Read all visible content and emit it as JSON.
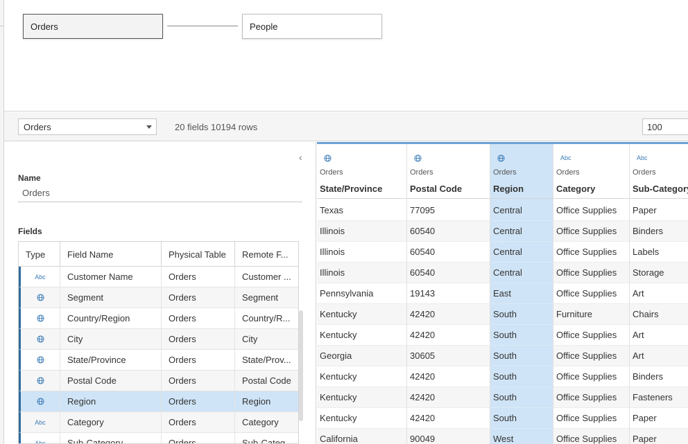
{
  "canvas": {
    "tables": [
      "Orders",
      "People"
    ]
  },
  "toolbar": {
    "selected_table": "Orders",
    "field_summary": "20 fields 10194 rows",
    "rows_value": "100"
  },
  "panel": {
    "collapse_glyph": "‹",
    "name_label": "Name",
    "name_value": "Orders",
    "fields_label": "Fields",
    "columns": [
      "Type",
      "Field Name",
      "Physical Table",
      "Remote F..."
    ],
    "rows": [
      {
        "type": "Abc",
        "name": "Customer Name",
        "table": "Orders",
        "remote": "Customer ..."
      },
      {
        "type": "globe",
        "name": "Segment",
        "table": "Orders",
        "remote": "Segment"
      },
      {
        "type": "globe",
        "name": "Country/Region",
        "table": "Orders",
        "remote": "Country/R..."
      },
      {
        "type": "globe",
        "name": "City",
        "table": "Orders",
        "remote": "City"
      },
      {
        "type": "globe",
        "name": "State/Province",
        "table": "Orders",
        "remote": "State/Prov..."
      },
      {
        "type": "globe",
        "name": "Postal Code",
        "table": "Orders",
        "remote": "Postal Code"
      },
      {
        "type": "globe",
        "name": "Region",
        "table": "Orders",
        "remote": "Region"
      },
      {
        "type": "Abc",
        "name": "Category",
        "table": "Orders",
        "remote": "Category"
      },
      {
        "type": "Abc",
        "name": "Sub-Category",
        "table": "Orders",
        "remote": "Sub-Categ..."
      }
    ]
  },
  "grid": {
    "columns": [
      {
        "icon": "globe",
        "source": "Orders",
        "name": "State/Province"
      },
      {
        "icon": "globe",
        "source": "Orders",
        "name": "Postal Code"
      },
      {
        "icon": "globe",
        "source": "Orders",
        "name": "Region"
      },
      {
        "icon": "Abc",
        "source": "Orders",
        "name": "Category"
      },
      {
        "icon": "Abc",
        "source": "Orders",
        "name": "Sub-Category"
      }
    ],
    "rows": [
      [
        "Texas",
        "77095",
        "Central",
        "Office Supplies",
        "Paper"
      ],
      [
        "Illinois",
        "60540",
        "Central",
        "Office Supplies",
        "Binders"
      ],
      [
        "Illinois",
        "60540",
        "Central",
        "Office Supplies",
        "Labels"
      ],
      [
        "Illinois",
        "60540",
        "Central",
        "Office Supplies",
        "Storage"
      ],
      [
        "Pennsylvania",
        "19143",
        "East",
        "Office Supplies",
        "Art"
      ],
      [
        "Kentucky",
        "42420",
        "South",
        "Furniture",
        "Chairs"
      ],
      [
        "Kentucky",
        "42420",
        "South",
        "Office Supplies",
        "Art"
      ],
      [
        "Georgia",
        "30605",
        "South",
        "Office Supplies",
        "Art"
      ],
      [
        "Kentucky",
        "42420",
        "South",
        "Office Supplies",
        "Binders"
      ],
      [
        "Kentucky",
        "42420",
        "South",
        "Office Supplies",
        "Fasteners"
      ],
      [
        "Kentucky",
        "42420",
        "South",
        "Office Supplies",
        "Paper"
      ],
      [
        "California",
        "90049",
        "West",
        "Office Supplies",
        "Paper"
      ]
    ]
  }
}
